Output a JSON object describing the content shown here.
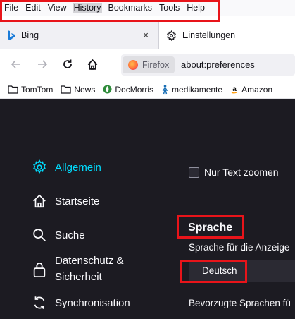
{
  "menu": {
    "items": [
      "File",
      "Edit",
      "View",
      "History",
      "Bookmarks",
      "Tools",
      "Help"
    ],
    "active_index": 3
  },
  "tabs": [
    {
      "label": "Bing",
      "icon": "bing-icon",
      "close": "×"
    },
    {
      "label": "Einstellungen",
      "icon": "gear-icon"
    }
  ],
  "navbar": {
    "identity_label": "Firefox",
    "url": "about:preferences"
  },
  "bookmarks": [
    {
      "label": "TomTom",
      "icon": "folder-icon"
    },
    {
      "label": "News",
      "icon": "folder-icon"
    },
    {
      "label": "DocMorris",
      "icon": "docmorris-icon"
    },
    {
      "label": "medikamente",
      "icon": "figure-icon"
    },
    {
      "label": "Amazon",
      "icon": "amazon-icon"
    }
  ],
  "sidebar": {
    "items": [
      {
        "label": "Allgemein",
        "icon": "gear-icon",
        "active": true
      },
      {
        "label": "Startseite",
        "icon": "home-icon"
      },
      {
        "label": "Suche",
        "icon": "search-icon"
      },
      {
        "label_line1": "Datenschutz &",
        "label_line2": "Sicherheit",
        "icon": "lock-icon"
      },
      {
        "label": "Synchronisation",
        "icon": "sync-icon"
      }
    ]
  },
  "main": {
    "zoom_text_only_label": "Nur Text zoomen",
    "zoom_text_only_checked": false,
    "language_section_title": "Sprache",
    "language_desc": "Sprache für die Anzeige",
    "language_selected": "Deutsch",
    "preferred_languages_desc": "Bevorzugte Sprachen fü"
  },
  "colors": {
    "accent": "#00ddff",
    "highlight": "#e8141a",
    "content_bg": "#1c1b22"
  }
}
